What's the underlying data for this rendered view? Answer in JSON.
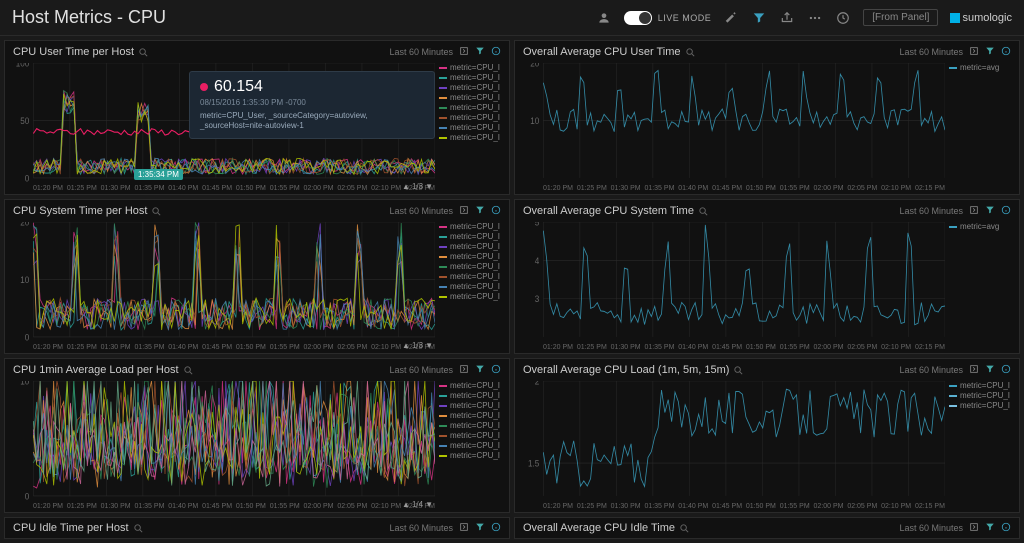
{
  "header": {
    "title": "Host Metrics - CPU",
    "live_mode_label": "LIVE MODE",
    "from_panel_label": "[From Panel]",
    "vendor": "sumologic"
  },
  "common": {
    "time_range_label": "Last 60 Minutes",
    "legend_metric_prefix": "metric=CPU_I",
    "legend_avg": "metric=avg",
    "pager_1_3": "1/3",
    "pager_1_4": "1/4"
  },
  "xaxis_ticks": [
    "01:20 PM",
    "01:25 PM",
    "01:30 PM",
    "01:35 PM",
    "01:40 PM",
    "01:45 PM",
    "01:50 PM",
    "01:55 PM",
    "02:00 PM",
    "02:05 PM",
    "02:10 PM",
    "02:15 PM"
  ],
  "tooltip": {
    "value": "60.154",
    "datetime": "08/15/2016 1:35:30 PM -0700",
    "meta": "metric=CPU_User, _sourceCategory=autoview, _sourceHost=nite-autoview-1",
    "time_badge": "1:35:34 PM"
  },
  "panels": [
    {
      "id": "p1",
      "title": "CPU User Time per Host",
      "legend_type": "multi",
      "pager": "1/3",
      "has_tooltip": true,
      "chart_data": {
        "type": "line",
        "xlabel": "",
        "ylabel": "",
        "ylim": [
          0,
          100
        ],
        "yticks": [
          0,
          50,
          100
        ],
        "series_colors": [
          "#d63384",
          "#2aa198",
          "#6f42c1",
          "#e08e3e",
          "#2e8b57",
          "#a0522d",
          "#4682b4",
          "#b0c400"
        ],
        "baseline_noise": 10,
        "spikes": [
          {
            "x": 3,
            "y": 60
          },
          {
            "x": 1,
            "y": 70
          }
        ],
        "accent_series": {
          "color": "#e91e63",
          "level": 40
        }
      }
    },
    {
      "id": "p2",
      "title": "Overall Average CPU User Time",
      "legend_type": "single",
      "chart_data": {
        "type": "line",
        "xlabel": "",
        "ylabel": "",
        "ylim": [
          0,
          20
        ],
        "yticks": [
          10,
          20
        ],
        "series_colors": [
          "#3aa0c0"
        ],
        "baseline": 10,
        "noise": 2,
        "periodic_spikes": {
          "count": 11,
          "height": 20
        }
      }
    },
    {
      "id": "p3",
      "title": "CPU System Time per Host",
      "legend_type": "multi",
      "pager": "1/3",
      "chart_data": {
        "type": "line",
        "xlabel": "",
        "ylabel": "",
        "ylim": [
          0,
          20
        ],
        "yticks": [
          0,
          10,
          20
        ],
        "series_colors": [
          "#d63384",
          "#2aa198",
          "#6f42c1",
          "#e08e3e",
          "#2e8b57",
          "#a0522d",
          "#4682b4",
          "#b0c400"
        ],
        "baseline_noise": 4,
        "periodic_spikes": {
          "count": 10,
          "height": 20
        }
      }
    },
    {
      "id": "p4",
      "title": "Overall Average CPU System Time",
      "legend_type": "single",
      "chart_data": {
        "type": "line",
        "xlabel": "",
        "ylabel": "",
        "ylim": [
          2,
          5
        ],
        "yticks": [
          3,
          4,
          5
        ],
        "series_colors": [
          "#3aa0c0"
        ],
        "baseline": 2.6,
        "noise": 0.3,
        "periodic_spikes": {
          "count": 10,
          "height": 5
        }
      }
    },
    {
      "id": "p5",
      "title": "CPU 1min Average Load per Host",
      "legend_type": "multi",
      "pager": "1/4",
      "chart_data": {
        "type": "line",
        "xlabel": "",
        "ylabel": "",
        "ylim": [
          0,
          10
        ],
        "yticks": [
          0,
          10
        ],
        "series_colors": [
          "#d63384",
          "#2aa198",
          "#6f42c1",
          "#e08e3e",
          "#2e8b57",
          "#a0522d",
          "#4682b4",
          "#b0c400",
          "#cc6699",
          "#66aa88"
        ],
        "baseline_noise": 4,
        "dense": true
      }
    },
    {
      "id": "p6",
      "title": "Overall Average CPU Load (1m, 5m, 15m)",
      "legend_type": "three",
      "chart_data": {
        "type": "line",
        "xlabel": "",
        "ylabel": "",
        "ylim": [
          1.3,
          2.0
        ],
        "yticks": [
          1.5,
          2
        ],
        "series_colors": [
          "#3aa0c0"
        ],
        "baseline": 1.5,
        "noise": 0.15,
        "step_up_at": 3,
        "step_to": 1.8
      }
    }
  ],
  "partial_panels": [
    {
      "title": "CPU Idle Time per Host"
    },
    {
      "title": "Overall Average CPU Idle Time"
    }
  ]
}
